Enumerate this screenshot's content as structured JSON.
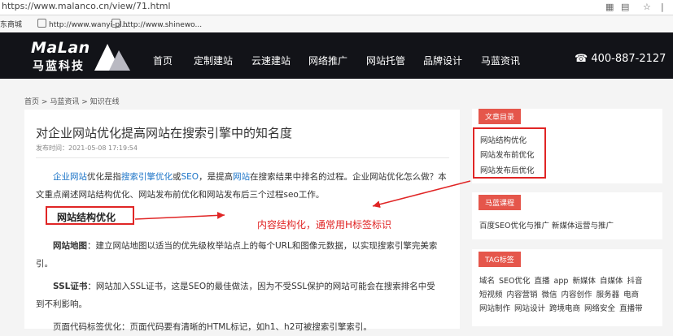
{
  "browser": {
    "url": "https://www.malanco.cn/view/71.html",
    "bookmarks": [
      "东商城",
      "http://www.wanyi-pl...",
      "http://www.shinewo..."
    ]
  },
  "header": {
    "logo_en": "MaLan",
    "logo_cn": "马蓝科技",
    "menu": [
      "首页",
      "定制建站",
      "云速建站",
      "网络推广",
      "网站托管",
      "品牌设计",
      "马蓝资讯"
    ],
    "phone": "400-887-2127",
    "bg_color": "#121318"
  },
  "breadcrumb": [
    "首页",
    ">",
    "马蓝资讯",
    ">",
    "知识在线"
  ],
  "article": {
    "title": "对企业网站优化提高网站在搜索引擎中的知名度",
    "date": "发布时间：2021-05-08 17:19:54",
    "intro_parts": [
      "企业网站",
      "优化是指",
      "搜索引擎优化",
      "或",
      "SEO",
      "，是提高",
      "网站",
      "在搜索结果中排名的过程。企业网站优化怎么做？本"
    ],
    "intro_line2": "文重点阐述网站结构优化、网站发布前优化和网站发布后三个过程seo工作。",
    "section_heading": "网站结构优化",
    "annotation": "内容结构化，通常用H标签标识",
    "p1_label": "网站地图",
    "p1_line1": "：建立网站地图以适当的优先级枚举站点上的每个URL和图像元数据，以实现搜索引擎完美索",
    "p1_line2": "引。",
    "p2_label": "SSL证书",
    "p2_line1": "：网站加入SSL证书，这是SEO的最佳做法，因为不受SSL保护的网站可能会在搜索排名中受",
    "p2_line2": "到不利影响。",
    "p3_partial": "页面代码标签优化：页面代码要有清晰的HTML标记，如h1、h2可被搜索引擎索引。"
  },
  "sidebar": {
    "toc_title": "文章目录",
    "toc": [
      "网站结构优化",
      "网站发布前优化",
      "网站发布后优化"
    ],
    "course_title": "马蓝课程",
    "course": "百度SEO优化与推广  新媒体运营与推广",
    "tags_title": "TAG标签",
    "tags": [
      "域名",
      "SEO优化",
      "直播",
      "app",
      "新媒体",
      "自媒体",
      "抖音",
      "短视频",
      "内容营销",
      "微信",
      "内容创作",
      "服务器",
      "电商",
      "网站制作",
      "网站设计",
      "跨境电商",
      "网络安全",
      "直播带"
    ]
  },
  "colors": {
    "accent": "#e5564b",
    "annotation": "#e02525",
    "link": "#1a73c7"
  }
}
